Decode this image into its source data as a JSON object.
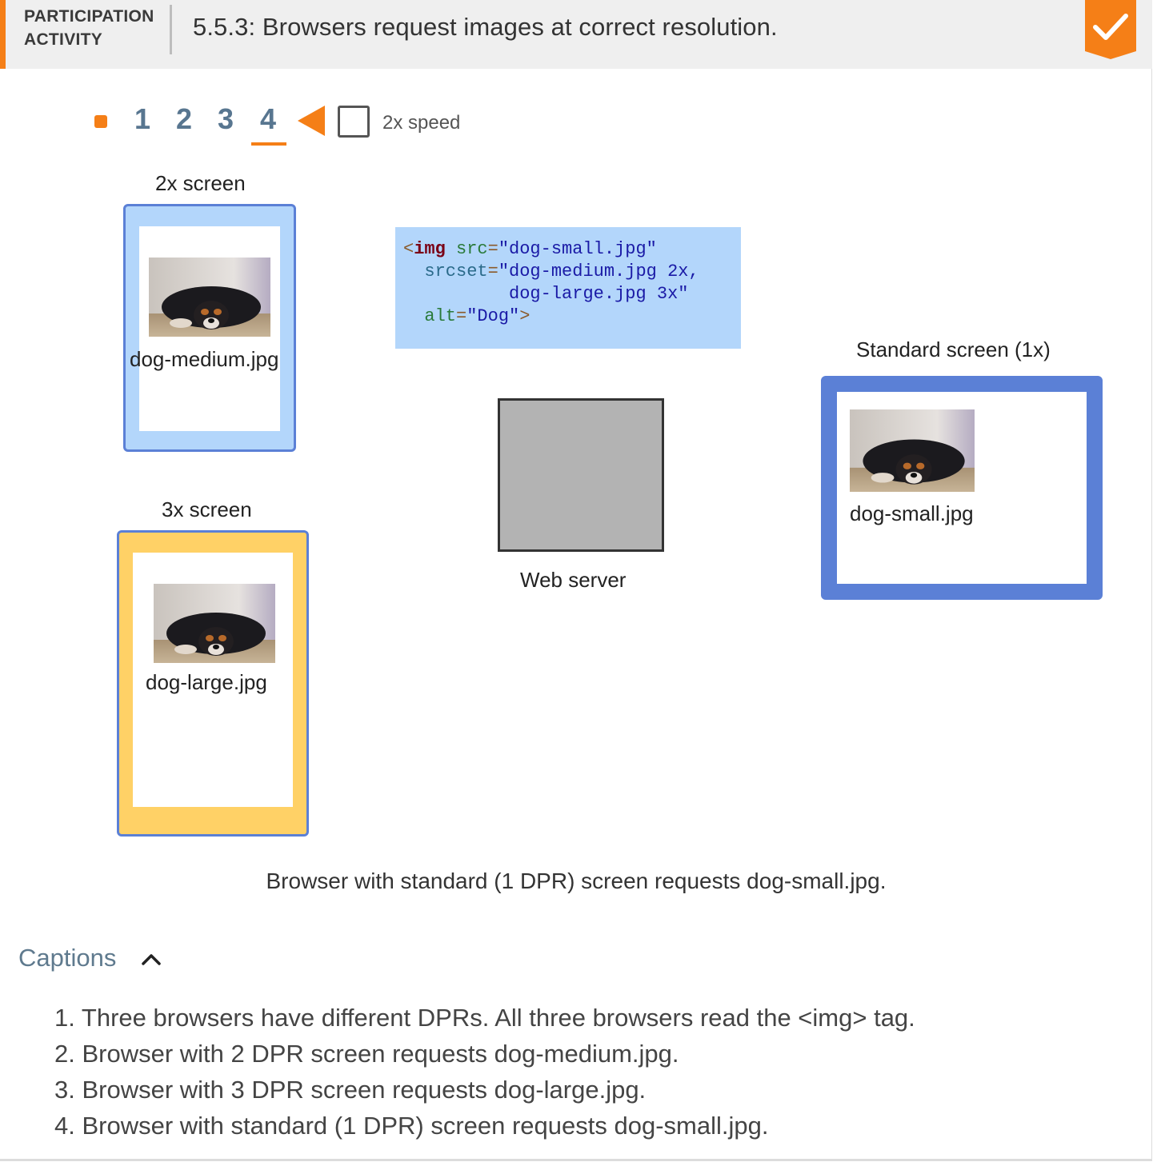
{
  "header": {
    "participation_line1": "PARTICIPATION",
    "participation_line2": "ACTIVITY",
    "title": "5.5.3: Browsers request images at correct resolution.",
    "badge_color": "#f57f17"
  },
  "controls": {
    "steps": [
      "1",
      "2",
      "3",
      "4"
    ],
    "current_step": "4",
    "speed_label": "2x speed",
    "speed_checked": false,
    "accent_color": "#f57f17"
  },
  "diagram": {
    "screen_2x": {
      "title": "2x screen",
      "file": "dog-medium.jpg",
      "color": "#b3d6fb"
    },
    "screen_3x": {
      "title": "3x screen",
      "file": "dog-large.jpg",
      "color": "#ffd166"
    },
    "screen_1x": {
      "title": "Standard screen (1x)",
      "file": "dog-small.jpg",
      "color": "#5b80d6"
    },
    "code": {
      "line1_tag": "img",
      "line1_attr": "src",
      "line1_value": "\"dog-small.jpg\"",
      "line2_attr": "srcset",
      "line2_value": "\"dog-medium.jpg 2x,",
      "line3_value": "dog-large.jpg 3x\"",
      "line4_attr": "alt",
      "line4_value": "\"Dog\""
    },
    "server_label": "Web server"
  },
  "step_caption": "Browser with standard (1 DPR) screen requests dog-small.jpg.",
  "captions": {
    "header": "Captions",
    "items": [
      "1. Three browsers have different DPRs. All three browsers read the <img> tag.",
      "2. Browser with 2 DPR screen requests dog-medium.jpg.",
      "3. Browser with 3 DPR screen requests dog-large.jpg.",
      "4. Browser with standard (1 DPR) screen requests dog-small.jpg."
    ]
  }
}
